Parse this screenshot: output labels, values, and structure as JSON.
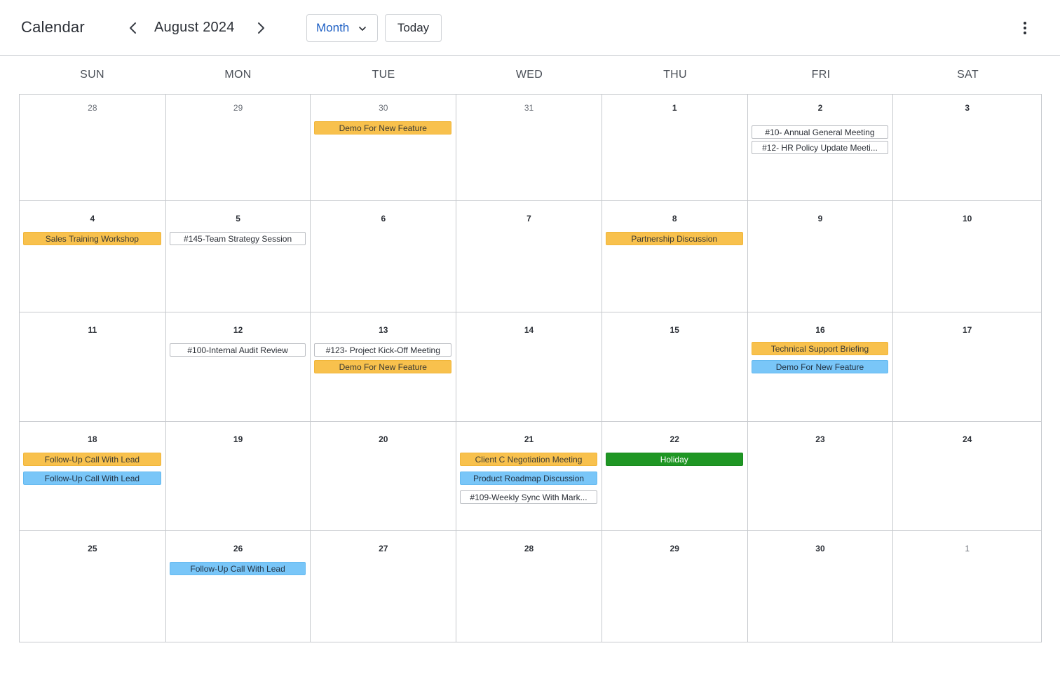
{
  "header": {
    "title": "Calendar",
    "month_label": "August 2024",
    "view_select": "Month",
    "today_label": "Today"
  },
  "weekdays": [
    "SUN",
    "MON",
    "TUE",
    "WED",
    "THU",
    "FRI",
    "SAT"
  ],
  "colors": {
    "orange": "#f8c14d",
    "blue": "#79c6f8",
    "green": "#1f9624",
    "accent": "#1d5fc4"
  },
  "weeks": [
    {
      "days": [
        {
          "num": "28",
          "muted": true,
          "events": []
        },
        {
          "num": "29",
          "muted": true,
          "events": []
        },
        {
          "num": "30",
          "muted": true,
          "events": [
            {
              "label": "Demo For New Feature",
              "style": "orange"
            }
          ]
        },
        {
          "num": "31",
          "muted": true,
          "events": []
        },
        {
          "num": "1",
          "muted": false,
          "events": []
        },
        {
          "num": "2",
          "muted": false,
          "events": [
            {
              "label": "#10- Annual General Meeting",
              "style": "outline"
            },
            {
              "label": "#12- HR Policy Update Meeti...",
              "style": "outline"
            }
          ]
        },
        {
          "num": "3",
          "muted": false,
          "events": []
        }
      ]
    },
    {
      "days": [
        {
          "num": "4",
          "muted": false,
          "events": [
            {
              "label": "Sales Training Workshop",
              "style": "orange"
            }
          ]
        },
        {
          "num": "5",
          "muted": false,
          "events": [
            {
              "label": "#145-Team Strategy Session",
              "style": "outline"
            }
          ]
        },
        {
          "num": "6",
          "muted": false,
          "events": []
        },
        {
          "num": "7",
          "muted": false,
          "events": []
        },
        {
          "num": "8",
          "muted": false,
          "events": [
            {
              "label": "Partnership Discussion",
              "style": "orange"
            }
          ]
        },
        {
          "num": "9",
          "muted": false,
          "events": []
        },
        {
          "num": "10",
          "muted": false,
          "events": []
        }
      ]
    },
    {
      "days": [
        {
          "num": "11",
          "muted": false,
          "events": []
        },
        {
          "num": "12",
          "muted": false,
          "events": [
            {
              "label": "#100-Internal Audit Review",
              "style": "outline"
            }
          ]
        },
        {
          "num": "13",
          "muted": false,
          "events": [
            {
              "label": "#123- Project Kick-Off Meeting",
              "style": "outline"
            },
            {
              "label": "Demo For New Feature",
              "style": "orange"
            }
          ]
        },
        {
          "num": "14",
          "muted": false,
          "events": []
        },
        {
          "num": "15",
          "muted": false,
          "events": []
        },
        {
          "num": "16",
          "muted": false,
          "events": [
            {
              "label": "Technical Support Briefing",
              "style": "orange"
            },
            {
              "label": "Demo For New Feature",
              "style": "blue"
            }
          ]
        },
        {
          "num": "17",
          "muted": false,
          "events": []
        }
      ]
    },
    {
      "days": [
        {
          "num": "18",
          "muted": false,
          "events": [
            {
              "label": "Follow-Up Call With Lead",
              "style": "orange"
            },
            {
              "label": "Follow-Up Call With Lead",
              "style": "blue"
            }
          ]
        },
        {
          "num": "19",
          "muted": false,
          "events": []
        },
        {
          "num": "20",
          "muted": false,
          "events": []
        },
        {
          "num": "21",
          "muted": false,
          "events": [
            {
              "label": "Client C Negotiation Meeting",
              "style": "orange"
            },
            {
              "label": "Product Roadmap Discussion",
              "style": "blue"
            },
            {
              "label": "#109-Weekly Sync With Mark...",
              "style": "outline"
            }
          ]
        },
        {
          "num": "22",
          "muted": false,
          "events": [
            {
              "label": "Holiday",
              "style": "green"
            }
          ]
        },
        {
          "num": "23",
          "muted": false,
          "events": []
        },
        {
          "num": "24",
          "muted": false,
          "events": []
        }
      ]
    },
    {
      "days": [
        {
          "num": "25",
          "muted": false,
          "events": []
        },
        {
          "num": "26",
          "muted": false,
          "events": [
            {
              "label": "Follow-Up Call With Lead",
              "style": "blue"
            }
          ]
        },
        {
          "num": "27",
          "muted": false,
          "events": []
        },
        {
          "num": "28",
          "muted": false,
          "events": []
        },
        {
          "num": "29",
          "muted": false,
          "events": []
        },
        {
          "num": "30",
          "muted": false,
          "events": []
        },
        {
          "num": "1",
          "muted": true,
          "events": []
        }
      ]
    }
  ]
}
